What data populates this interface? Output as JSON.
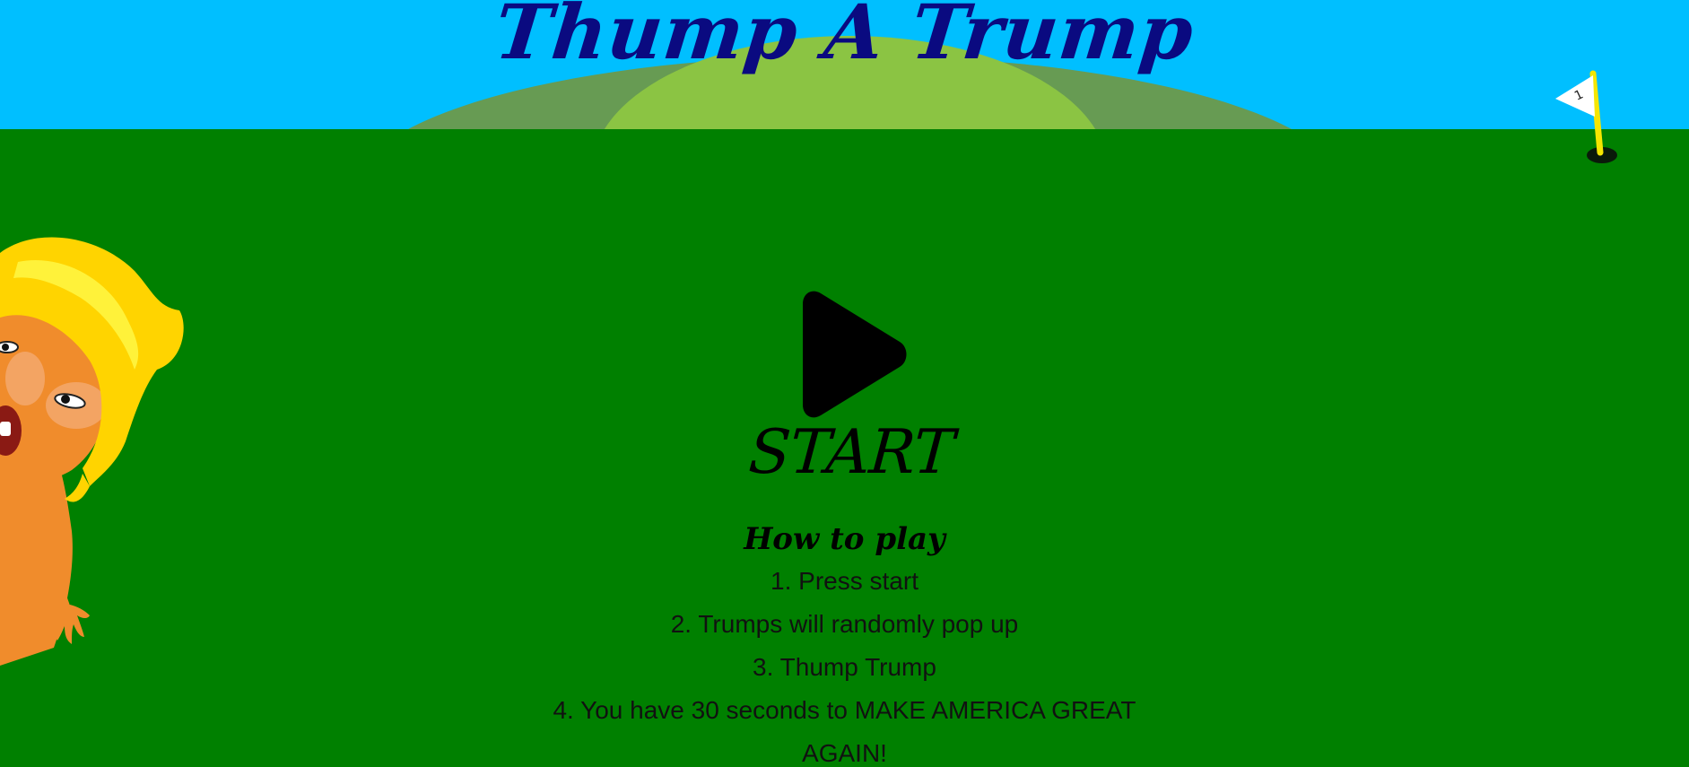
{
  "game": {
    "title": "Thump A Trump",
    "start_label": "START"
  },
  "flag": {
    "number": "1"
  },
  "howto": {
    "title": "How to play",
    "steps": [
      "1. Press start",
      "2. Trumps will randomly pop up",
      "3. Thump Trump",
      "4. You have 30 seconds to MAKE AMERICA GREAT AGAIN!"
    ]
  },
  "colors": {
    "sky": "#00bfff",
    "grass": "#008000",
    "hill_back": "#679b53",
    "hill_front": "#8bc443",
    "title": "#0a0a80",
    "flag_pole": "#f5e600",
    "hair": "#ffd400",
    "skin": "#f08c2c"
  },
  "icons": {
    "start": "play-icon",
    "flag": "golf-flag-icon",
    "character": "trump-caricature"
  }
}
